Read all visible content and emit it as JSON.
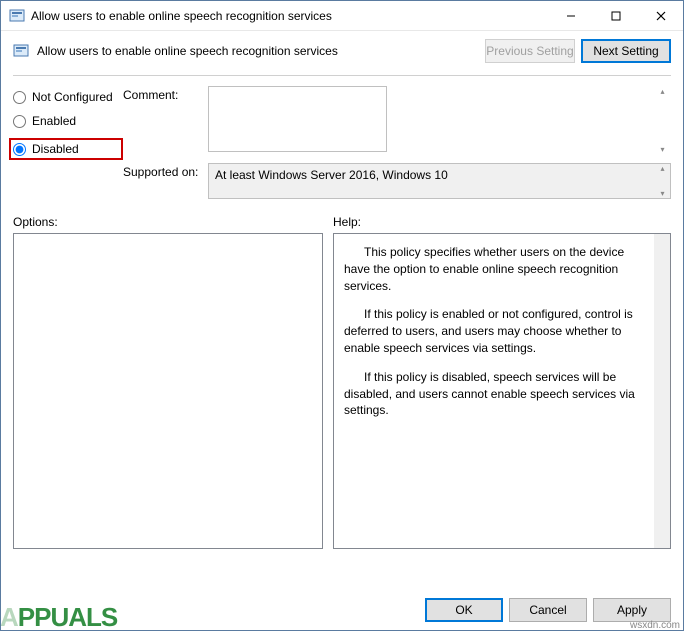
{
  "window": {
    "title": "Allow users to enable online speech recognition services"
  },
  "header": {
    "subtitle": "Allow users to enable online speech recognition services",
    "prev_label": "Previous Setting",
    "next_label": "Next Setting"
  },
  "settings": {
    "not_configured_label": "Not Configured",
    "enabled_label": "Enabled",
    "disabled_label": "Disabled",
    "selected": "disabled",
    "comment_label": "Comment:",
    "comment_value": "",
    "supported_label": "Supported on:",
    "supported_value": "At least Windows Server 2016, Windows 10"
  },
  "labels": {
    "options": "Options:",
    "help": "Help:"
  },
  "help": {
    "p1": "This policy specifies whether users on the device have the option to enable online speech recognition services.",
    "p2": "If this policy is enabled or not configured, control is deferred to users, and users may choose whether to enable speech services via settings.",
    "p3": "If this policy is disabled, speech services will be disabled, and users cannot enable speech services via settings."
  },
  "footer": {
    "ok": "OK",
    "cancel": "Cancel",
    "apply": "Apply"
  },
  "watermark": {
    "brand": "PPUALS",
    "source": "wsxdn.com"
  }
}
